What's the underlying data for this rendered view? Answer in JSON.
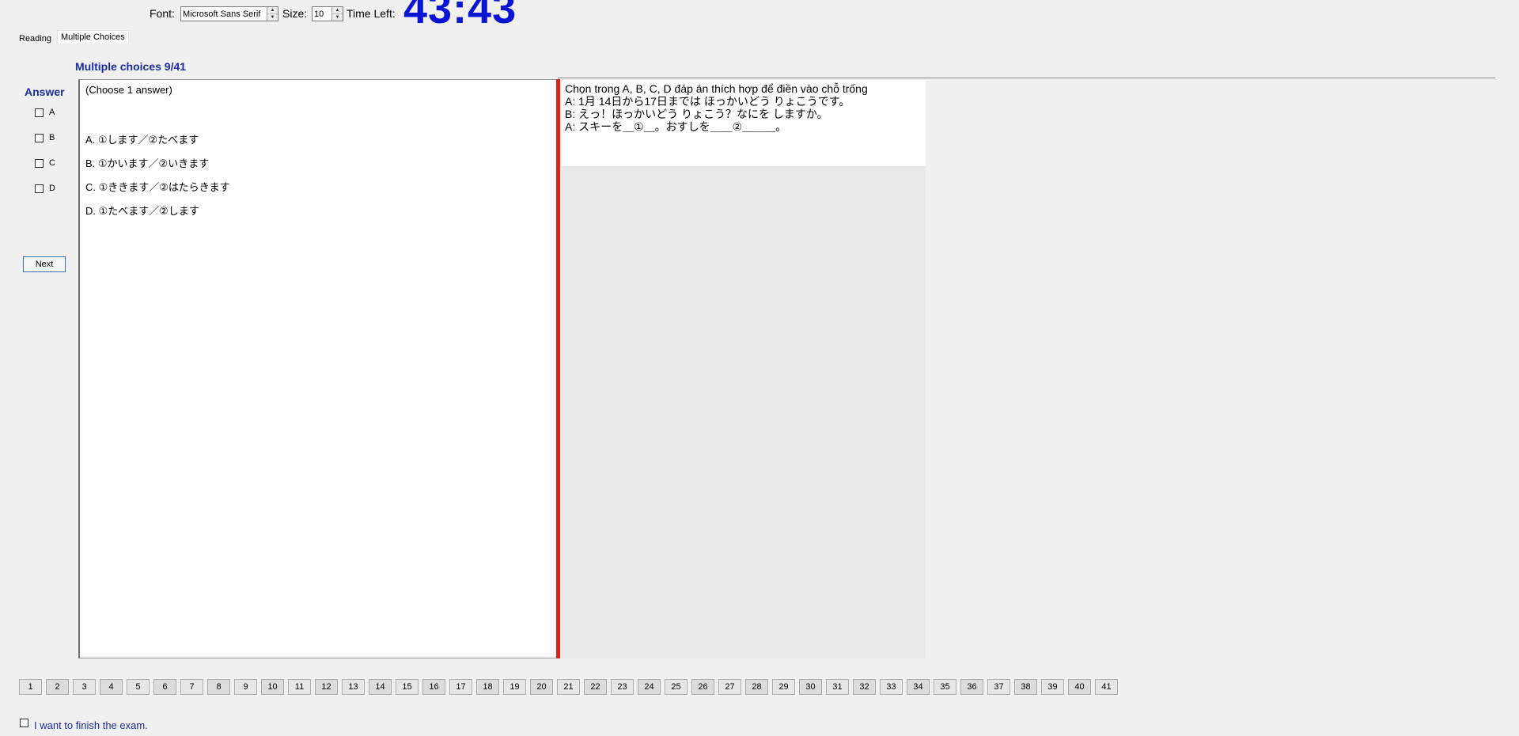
{
  "toolbar": {
    "font_label": "Font:",
    "font_value": "Microsoft Sans Serif",
    "size_label": "Size:",
    "size_value": "10",
    "time_label": "Time Left:",
    "time_value": "43:43"
  },
  "tabs": [
    {
      "label": "Reading",
      "active": false
    },
    {
      "label": "Multiple Choices",
      "active": true
    }
  ],
  "section_title": "Multiple choices 9/41",
  "answer": {
    "title": "Answer",
    "options": [
      "A",
      "B",
      "C",
      "D"
    ],
    "next_label": "Next"
  },
  "question": {
    "instruction": "(Choose 1 answer)",
    "choices": [
      "A.  ①します／②たべます",
      "B.  ①かいます／②いきます",
      "C.  ①ききます／②はたらきます",
      "D.  ①たべます／②します"
    ]
  },
  "passage": {
    "lines": [
      "Chọn trong A, B, C, D đáp án thích hợp để điền vào chỗ trống",
      "A:   1月 14日から17日までは   ほっかいどう  りょこうです。",
      "B:   えっ！ほっかいどう  りょこう？なにを  しますか。",
      "A:    スキーを＿①＿。おすしを＿＿②＿＿＿。"
    ]
  },
  "question_nav": [
    "1",
    "2",
    "3",
    "4",
    "5",
    "6",
    "7",
    "8",
    "9",
    "10",
    "11",
    "12",
    "13",
    "14",
    "15",
    "16",
    "17",
    "18",
    "19",
    "20",
    "21",
    "22",
    "23",
    "24",
    "25",
    "26",
    "27",
    "28",
    "29",
    "30",
    "31",
    "32",
    "33",
    "34",
    "35",
    "36",
    "37",
    "38",
    "39",
    "40",
    "41"
  ],
  "finish_label": "I want to finish the exam.",
  "colors": {
    "timer": "#0a14d2",
    "title": "#1c2aa0",
    "divider": "#d4261c"
  }
}
